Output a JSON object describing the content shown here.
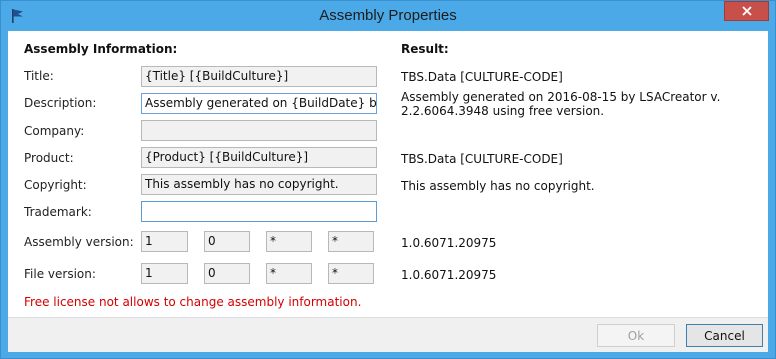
{
  "window": {
    "title": "Assembly Properties",
    "close_glyph": "✕",
    "icon": "flag-icon",
    "accent": "#4aa9e6"
  },
  "sections": {
    "info_heading": "Assembly Information:",
    "result_heading": "Result:"
  },
  "fields": {
    "title": {
      "label": "Title:",
      "value": "{Title} [{BuildCulture}]",
      "result": "TBS.Data [CULTURE-CODE]"
    },
    "description": {
      "label": "Description:",
      "value": "Assembly generated on {BuildDate} by",
      "result_line1": "Assembly generated on 2016-08-15 by LSACreator v.",
      "result_line2": "2.2.6064.3948 using free version."
    },
    "company": {
      "label": "Company:",
      "value": "",
      "result": ""
    },
    "product": {
      "label": "Product:",
      "value": "{Product} [{BuildCulture}]",
      "result": "TBS.Data [CULTURE-CODE]"
    },
    "copyright": {
      "label": "Copyright:",
      "value": "This assembly has no copyright.",
      "result": "This assembly has no copyright."
    },
    "trademark": {
      "label": "Trademark:",
      "value": "",
      "result": ""
    }
  },
  "versions": {
    "assembly": {
      "label": "Assembly version:",
      "parts": [
        "1",
        "0",
        "*",
        "*"
      ],
      "result": "1.0.6071.20975"
    },
    "file": {
      "label": "File version:",
      "parts": [
        "1",
        "0",
        "*",
        "*"
      ],
      "result": "1.0.6071.20975"
    }
  },
  "warning": "Free license not allows to change assembly information.",
  "buttons": {
    "ok": "Ok",
    "cancel": "Cancel"
  }
}
